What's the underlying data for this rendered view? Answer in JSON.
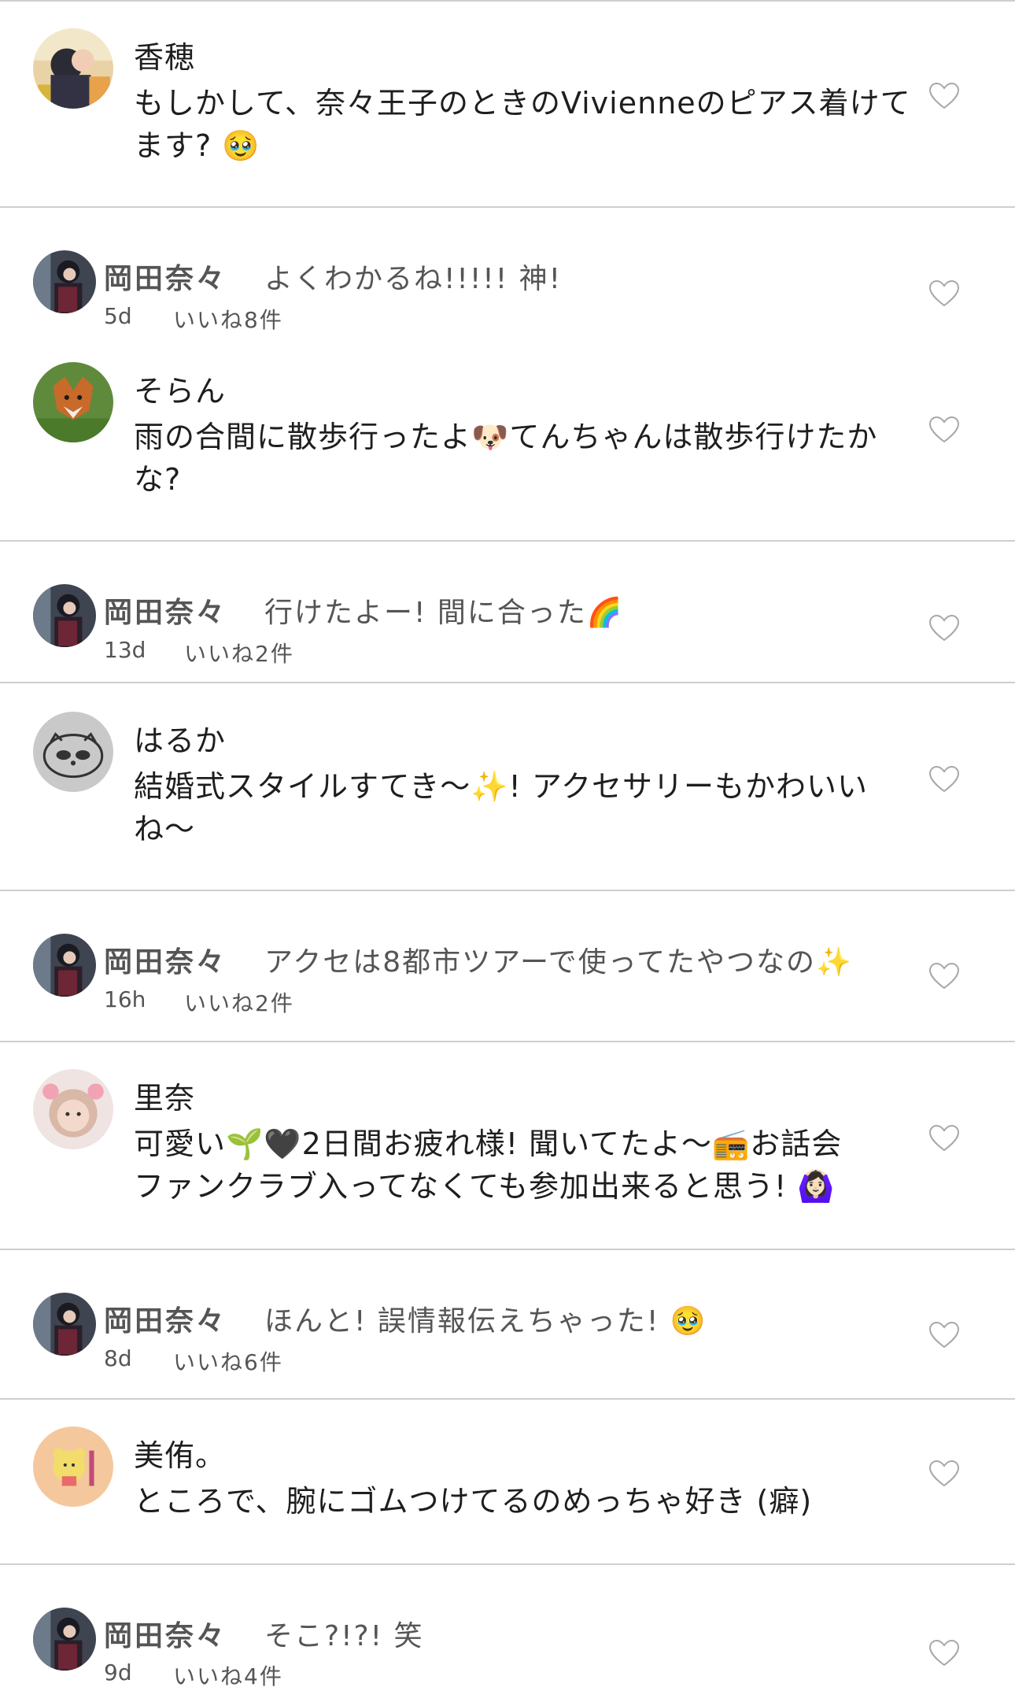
{
  "colors": {
    "divider": "#cfcfcf",
    "text": "#1e1e1e",
    "muted": "#555555",
    "heart_outline": "#a8a8a8"
  },
  "comments": [
    {
      "name": "香穂",
      "text": "もしかして、奈々王子のときのVivienneのピアス着けてます? 🥹",
      "avatar": "user-photo-avatar"
    },
    {
      "name": "岡田奈々",
      "text": "よくわかるね!!!!! 神!",
      "time": "5d",
      "likes": "いいね8件",
      "avatar": "okada-nana-avatar"
    },
    {
      "name": "そらん",
      "text": "雨の合間に散歩行ったよ🐶てんちゃんは散歩行けたかな?",
      "avatar": "fox-avatar"
    },
    {
      "name": "岡田奈々",
      "text": "行けたよー! 間に合った🌈",
      "time": "13d",
      "likes": "いいね2件",
      "avatar": "okada-nana-avatar"
    },
    {
      "name": "はるか",
      "text": "結婚式スタイルすてき〜✨! アクセサリーもかわいいね〜",
      "avatar": "raccoon-drawing-avatar"
    },
    {
      "name": "岡田奈々",
      "text": "アクセは8都市ツアーで使ってたやつなの✨",
      "time": "16h",
      "likes": "いいね2件",
      "avatar": "okada-nana-avatar"
    },
    {
      "name": "里奈",
      "text_line1": "可愛い🌱🖤2日間お疲れ様! 聞いてたよ〜📻お話会",
      "text_line2": "ファンクラブ入ってなくても参加出来ると思う! 🙆🏻‍♀️",
      "avatar": "user-photo-avatar"
    },
    {
      "name": "岡田奈々",
      "text": "ほんと! 誤情報伝えちゃった! 🥹",
      "time": "8d",
      "likes": "いいね6件",
      "avatar": "okada-nana-avatar"
    },
    {
      "name": "美侑。",
      "text": "ところで、腕にゴムつけてるのめっちゃ好き (癖)",
      "avatar": "bear-sticker-avatar"
    },
    {
      "name": "岡田奈々",
      "text": "そこ?!?! 笑",
      "time": "9d",
      "likes": "いいね4件",
      "avatar": "okada-nana-avatar"
    }
  ]
}
